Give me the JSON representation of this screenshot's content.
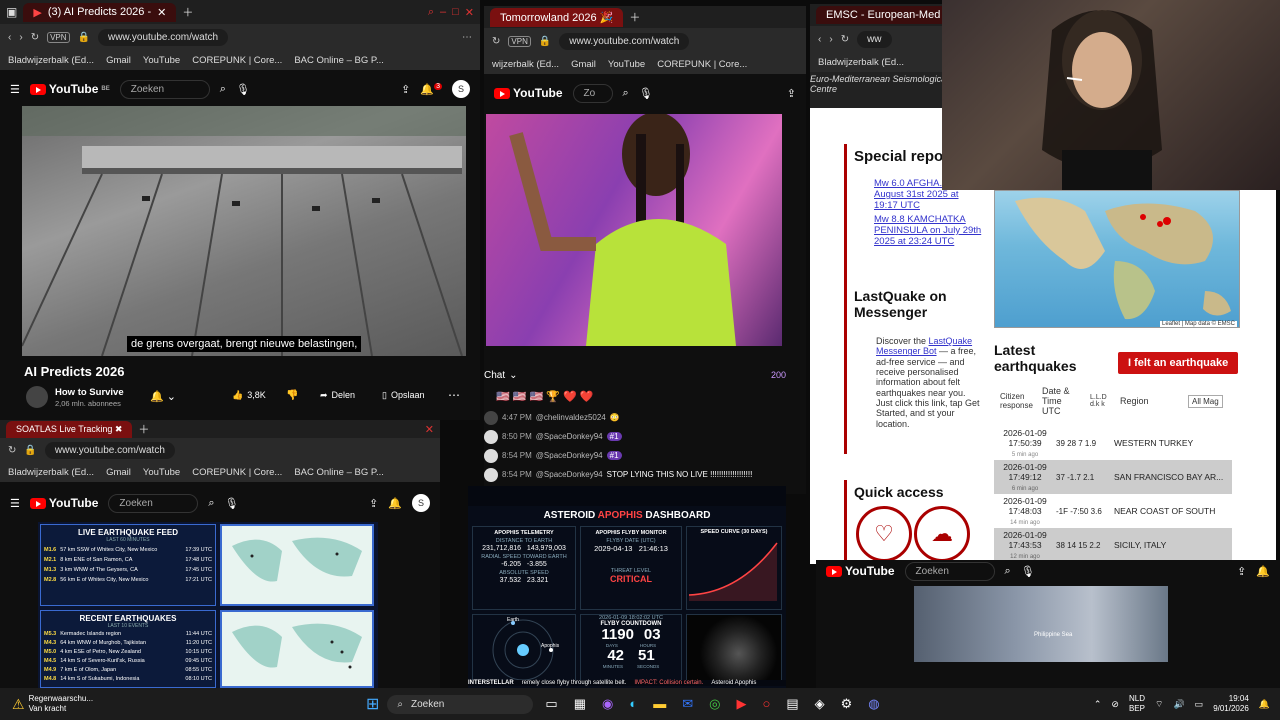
{
  "win1": {
    "tab_title": "(3) AI Predicts 2026 -",
    "url": "www.youtube.com/watch",
    "bookmarks": [
      "Bladwijzerbalk (Ed...",
      "Gmail",
      "YouTube",
      "COREPUNK | Core...",
      "BAC Online – BG P..."
    ],
    "search_placeholder": "Zoeken",
    "subtitle": "de grens overgaat, brengt nieuwe belastingen,",
    "video_title": "AI Predicts 2026",
    "channel": "How to Survive",
    "subscribers": "2,06 mln. abonnees",
    "likes": "3,8K",
    "share": "Delen",
    "save": "Opslaan",
    "notif_count": "3",
    "avatar": "S",
    "region": "BE"
  },
  "win2": {
    "tab_title": "Tomorrowland 2026 🎉",
    "url": "www.youtube.com/watch",
    "bookmarks": [
      "wijzerbalk (Ed...",
      "Gmail",
      "YouTube",
      "COREPUNK | Core..."
    ],
    "search_placeholder": "Zo",
    "chat_label": "Chat",
    "viewers": "200",
    "chat": [
      {
        "time": "4:47 PM",
        "user": "@chelinvaldez5024",
        "msg": "😳"
      },
      {
        "time": "8:50 PM",
        "user": "@SpaceDonkey94",
        "msg": "#1"
      },
      {
        "time": "8:54 PM",
        "user": "@SpaceDonkey94",
        "msg": "#1"
      },
      {
        "time": "8:54 PM",
        "user": "@SpaceDonkey94",
        "msg": "STOP LYING THIS NO LIVE !!!!!!!!!!!!!!!!!!!"
      }
    ]
  },
  "win3": {
    "tab_title": "EMSC - European-Med",
    "url": "ww",
    "bookmarks": [
      "Bladwijzerbalk (Ed..."
    ],
    "header_lines": [
      "Euro-Mediterranean Seismological",
      "Centre"
    ],
    "special_reports_title": "Special repo",
    "reports": [
      "Mw 6.0 AFGHA... on August 31st 2025 at 19:17 UTC",
      "Mw 8.8 KAMCHATKA PENINSULA on July 29th 2025 at 23:24 UTC"
    ],
    "lastquake_title": "LastQuake on Messenger",
    "lastquake_text": [
      "Discover the",
      "LastQuake Messenger Bot",
      "— a free, ad-free service — and receive personalised information about felt earthquakes near you.",
      "Just click this link, tap Get Started, and st your location."
    ],
    "quick_access": "Quick access",
    "latest_title": "Latest earthquakes",
    "felt_button": "I felt an earthquake",
    "map_credit": "Leaflet | Map data © EMSC",
    "columns": {
      "citizen": "Citizen response",
      "datetime": "Date & Time UTC",
      "lat": "L.L.D d.k k",
      "region": "Region",
      "filter": "All Mag"
    },
    "quakes": [
      {
        "date": "2026-01-09",
        "time": "17:50:39",
        "ago": "5 min ago",
        "mag": "39 28 7   1.9",
        "region": "WESTERN TURKEY"
      },
      {
        "date": "2026-01-09",
        "time": "17:49:12",
        "ago": "6 min ago",
        "mag": "37 -1.7  2.1",
        "region": "SAN FRANCISCO BAY AR..."
      },
      {
        "date": "2026-01-09",
        "time": "17:48:03",
        "ago": "14 min ago",
        "mag": "-1F -7:50 3.6",
        "region": "NEAR COAST OF SOUTH"
      },
      {
        "date": "2026-01-09",
        "time": "17:43:53",
        "ago": "12 min ago",
        "mag": "38 14 15 2.2",
        "region": "SICILY, ITALY"
      }
    ]
  },
  "win4": {
    "tab_title": "SOATLAS Live Tracking ✖",
    "url": "www.youtube.com/watch",
    "bookmarks": [
      "Bladwijzerbalk (Ed...",
      "Gmail",
      "YouTube",
      "COREPUNK | Core...",
      "BAC Online – BG P..."
    ],
    "search_placeholder": "Zoeken",
    "feed_title": "LIVE EARTHQUAKE FEED",
    "feed_sub": "LAST 60 MINUTES",
    "feed_rows": [
      [
        "M1.6",
        "57 km SSW of Whites City, New Mexico",
        "17:39 UTC"
      ],
      [
        "M2.1",
        "8 km ENE of San Ramon, CA",
        "17:48 UTC"
      ],
      [
        "M1.3",
        "3 km WNW of The Geysers, CA",
        "17:45 UTC"
      ],
      [
        "M2.8",
        "56 km E of Whites City, New Mexico",
        "17:21 UTC"
      ]
    ],
    "recent_title": "RECENT EARTHQUAKES",
    "recent_sub": "LAST 10 EVENTS",
    "recent_rows": [
      [
        "M5.3",
        "Kermadec Islands region",
        "11:44 UTC"
      ],
      [
        "M4.3",
        "64 km WNW of Murghob, Tajikistan",
        "11:20 UTC"
      ],
      [
        "M5.0",
        "4 km ESE of Petro, New Zealand",
        "10:15 UTC"
      ],
      [
        "M4.5",
        "14 km S of Severo-Kuril'sk, Russia",
        "09:45 UTC"
      ],
      [
        "M4.9",
        "7 km E of Olom, Japan",
        "08:55 UTC"
      ],
      [
        "M4.8",
        "14 km S of Sukabumi, Indonesia",
        "08:10 UTC"
      ]
    ]
  },
  "win5": {
    "dashboard_title": [
      "ASTEROID ",
      "APOPHIS",
      " DASHBOARD"
    ],
    "telemetry": "APOPHIS TELEMETRY",
    "flyby_monitor": "APOPHIS FLYBY MONITOR",
    "speed_curve": "SPEED CURVE (30 DAYS)",
    "dist_label": "DISTANCE TO EARTH",
    "dist_km": "231,712,816",
    "dist_mi": "143,979,003",
    "radial_label": "RADIAL SPEED TOWARD EARTH",
    "radial_a": "-6.205",
    "radial_b": "-3.855",
    "abs_label": "ABSOLUTE SPEED",
    "abs_a": "37.532",
    "abs_b": "23.321",
    "flyby_date_label": "FLYBY DATE (UTC)",
    "flyby_date": "2029-04-13",
    "flyby_time": "21:46:13",
    "threat_label": "THREAT LEVEL",
    "threat": "CRITICAL",
    "clock": "2026-01-09 18:02:02 UTC",
    "countdown_label": "FLYBY COUNTDOWN",
    "days": "1190",
    "hours": "03",
    "minutes": "42",
    "seconds": "51",
    "units": [
      "DAYS",
      "HOURS",
      "MINUTES",
      "SECONDS"
    ],
    "ticker": "remely close flyby through satellite belt.",
    "ticker2": "IMPACT: Collision certain.",
    "ticker3": "Asteroid Apophis",
    "earth_label": "Earth",
    "apophis_label": "Apophis",
    "orbit_brand": "INTERSTELLAR"
  },
  "win6": {
    "search_placeholder": "Zoeken",
    "map_label": "Philippine Sea"
  },
  "taskbar": {
    "weather_title": "Regenwaarschu...",
    "weather_sub": "Van kracht",
    "search": "Zoeken",
    "lang": "NLD",
    "lang_sub": "BEP",
    "time": "19:04",
    "date": "9/01/2026"
  }
}
